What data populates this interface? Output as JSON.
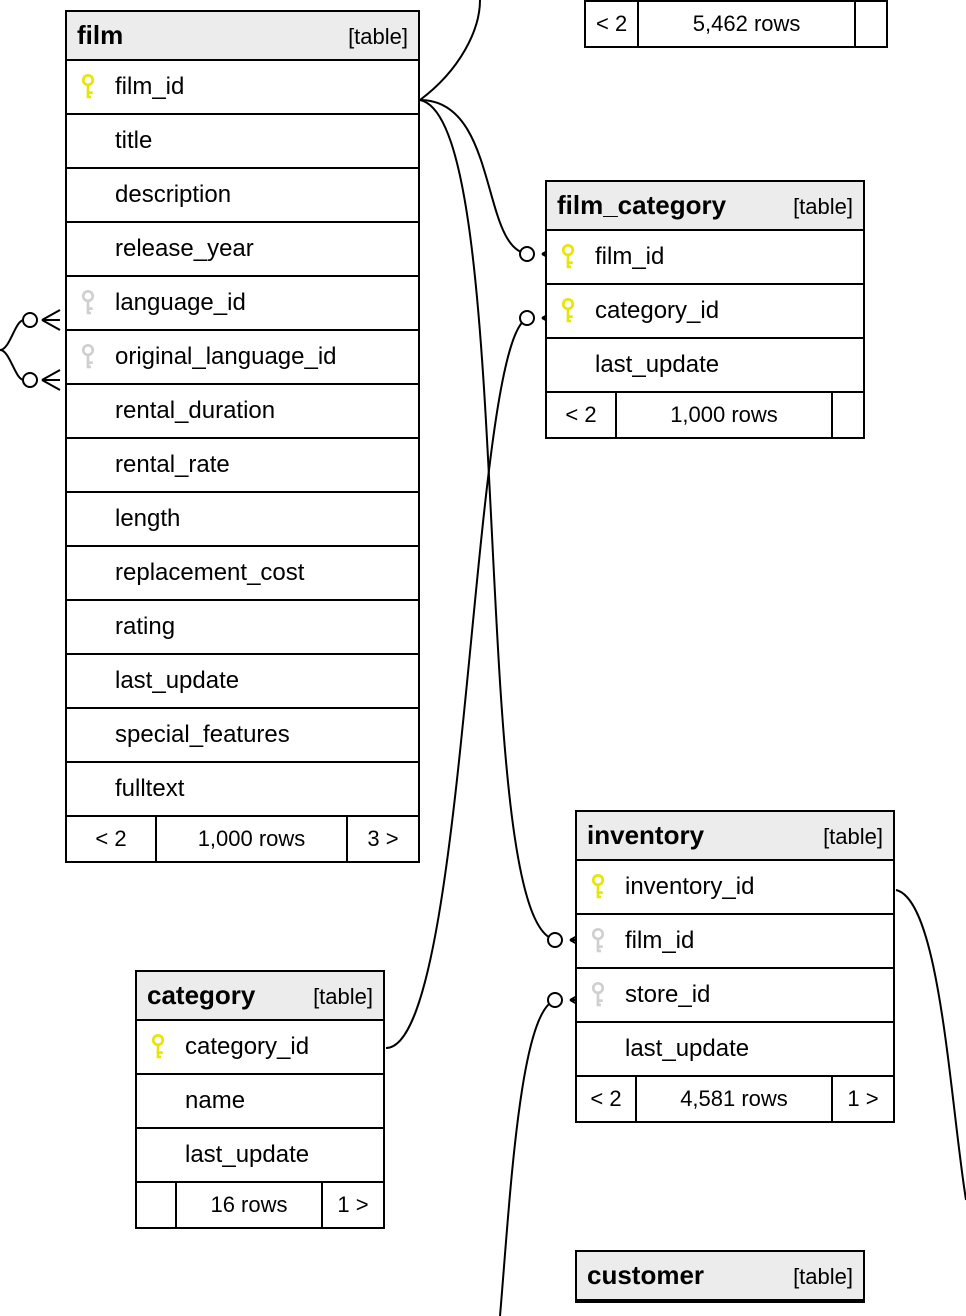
{
  "labels": {
    "table": "[table]"
  },
  "schema": {
    "tables": [
      {
        "name": "film",
        "cols": [
          {
            "n": "film_id",
            "k": "pk"
          },
          {
            "n": "title",
            "k": null
          },
          {
            "n": "description",
            "k": null
          },
          {
            "n": "release_year",
            "k": null
          },
          {
            "n": "language_id",
            "k": "fk"
          },
          {
            "n": "original_language_id",
            "k": "fk"
          },
          {
            "n": "rental_duration",
            "k": null
          },
          {
            "n": "rental_rate",
            "k": null
          },
          {
            "n": "length",
            "k": null
          },
          {
            "n": "replacement_cost",
            "k": null
          },
          {
            "n": "rating",
            "k": null
          },
          {
            "n": "last_update",
            "k": null
          },
          {
            "n": "special_features",
            "k": null
          },
          {
            "n": "fulltext",
            "k": null
          }
        ],
        "footer": {
          "left": "< 2",
          "rows": "1,000 rows",
          "right": "3 >"
        }
      },
      {
        "name": "film_category",
        "cols": [
          {
            "n": "film_id",
            "k": "pk"
          },
          {
            "n": "category_id",
            "k": "pk"
          },
          {
            "n": "last_update",
            "k": null
          }
        ],
        "footer": {
          "left": "< 2",
          "rows": "1,000 rows",
          "right": ""
        }
      },
      {
        "name": "category",
        "cols": [
          {
            "n": "category_id",
            "k": "pk"
          },
          {
            "n": "name",
            "k": null
          },
          {
            "n": "last_update",
            "k": null
          }
        ],
        "footer": {
          "left": "",
          "rows": "16 rows",
          "right": "1 >"
        }
      },
      {
        "name": "inventory",
        "cols": [
          {
            "n": "inventory_id",
            "k": "pk"
          },
          {
            "n": "film_id",
            "k": "fk"
          },
          {
            "n": "store_id",
            "k": "fk"
          },
          {
            "n": "last_update",
            "k": null
          }
        ],
        "footer": {
          "left": "< 2",
          "rows": "4,581 rows",
          "right": "1 >"
        }
      },
      {
        "name": "customer",
        "cols": [],
        "footer": null
      }
    ],
    "orphan_footer": {
      "left": "< 2",
      "rows": "5,462 rows",
      "right": ""
    }
  }
}
